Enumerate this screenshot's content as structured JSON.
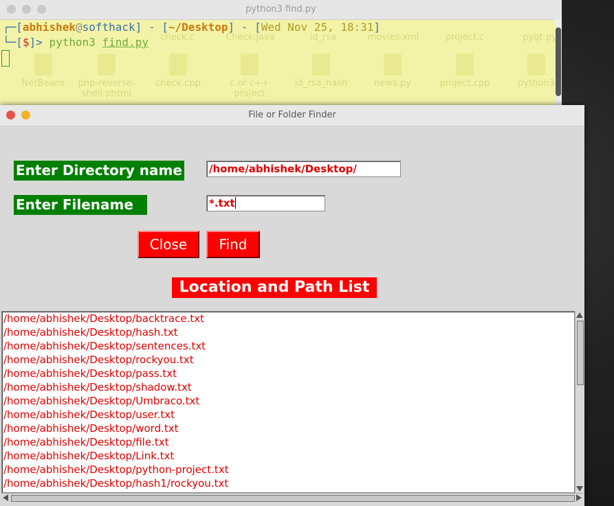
{
  "terminal": {
    "title": "python3 find.py",
    "prompt": {
      "user": "abhishek",
      "at": "@",
      "host": "softhack",
      "path": "~/Desktop",
      "datetime": "Wed Nov 25, 18:31",
      "dollar": "$",
      "command": "python3",
      "arg": "find.py"
    },
    "desktop_icons_row1": [
      "check.c",
      "Check.java",
      "id_rsa",
      "movies.xml",
      "project.c",
      "pyqt.py"
    ],
    "desktop_icons_row2": [
      "NetBeans",
      "php-reverse-shell.phtml",
      "check.cpp",
      "c or c++ project",
      "id_rsa_hash",
      "news.py",
      "project.cpp",
      "python3"
    ]
  },
  "app": {
    "title": "File or Folder Finder",
    "directory_label": "Enter Directory name",
    "directory_value": "/home/abhishek/Desktop/",
    "filename_label": "Enter Filename",
    "filename_value": "*.txt",
    "close_label": "Close",
    "find_label": "Find",
    "list_heading": "Location and Path List",
    "results": [
      "/home/abhishek/Desktop/backtrace.txt",
      "/home/abhishek/Desktop/hash.txt",
      "/home/abhishek/Desktop/sentences.txt",
      "/home/abhishek/Desktop/rockyou.txt",
      "/home/abhishek/Desktop/pass.txt",
      "/home/abhishek/Desktop/shadow.txt",
      "/home/abhishek/Desktop/Umbraco.txt",
      "/home/abhishek/Desktop/user.txt",
      "/home/abhishek/Desktop/word.txt",
      "/home/abhishek/Desktop/file.txt",
      "/home/abhishek/Desktop/Link.txt",
      "/home/abhishek/Desktop/python-project.txt",
      "/home/abhishek/Desktop/hash1/rockyou.txt"
    ]
  },
  "colors": {
    "label_bg": "#008000",
    "button_bg": "#ff0000",
    "result_text": "#e00000",
    "terminal_bg": "#f3f3a8"
  }
}
